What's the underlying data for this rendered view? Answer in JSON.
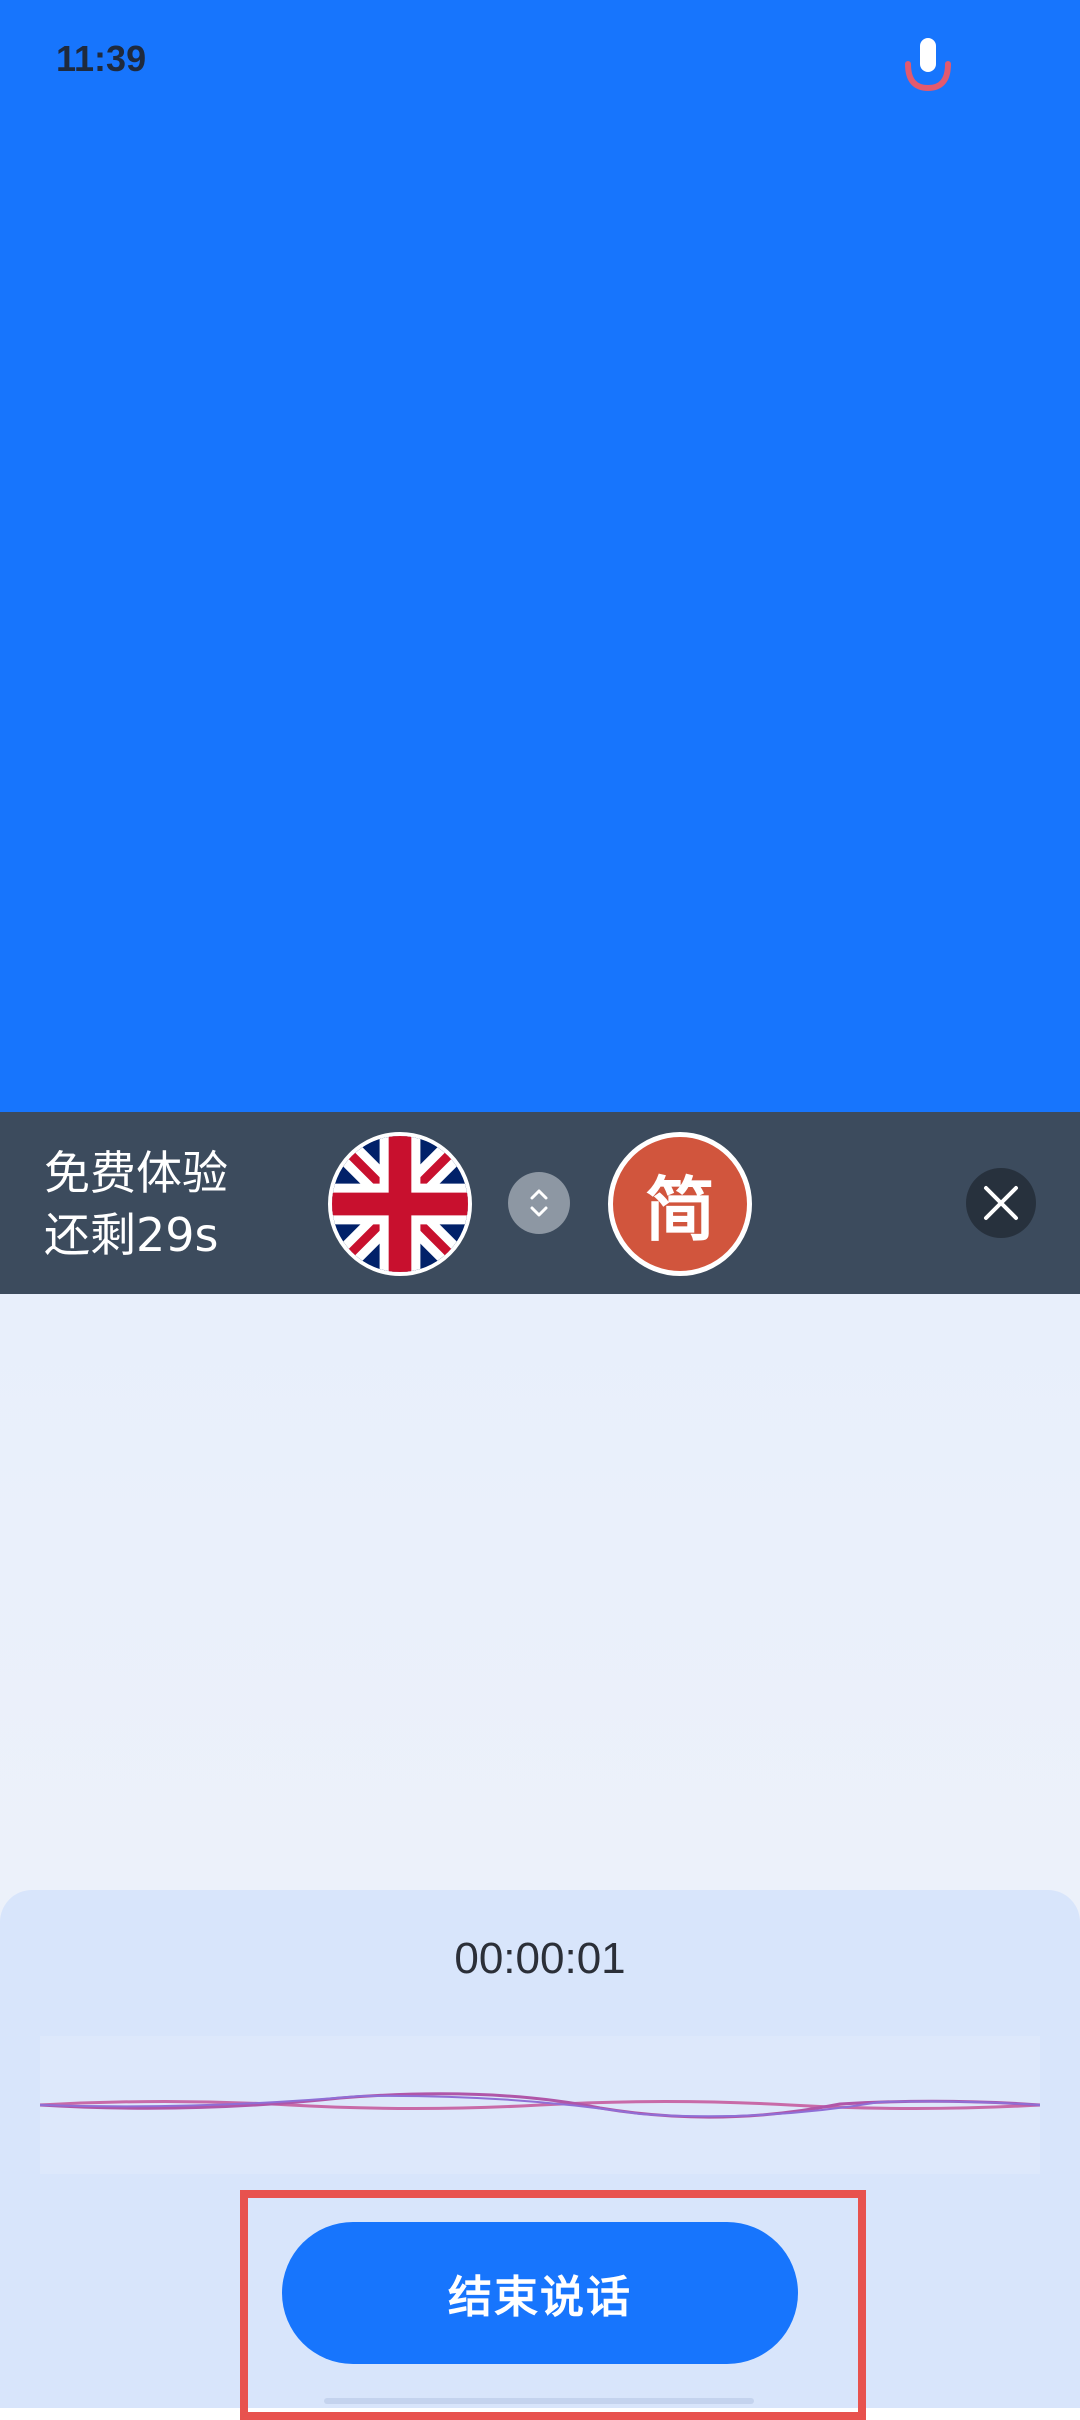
{
  "status_bar": {
    "time": "11:39"
  },
  "language_bar": {
    "trial_line1": "免费体验",
    "trial_line2": "还剩29s",
    "target_language_badge": "简"
  },
  "recorder": {
    "timer": "00:00:01",
    "end_button_label": "结束说话"
  },
  "colors": {
    "primary_blue": "#1775fd",
    "language_bar": "#3c4b5d",
    "zh_badge": "#d1553d",
    "highlight": "#e8524e"
  }
}
